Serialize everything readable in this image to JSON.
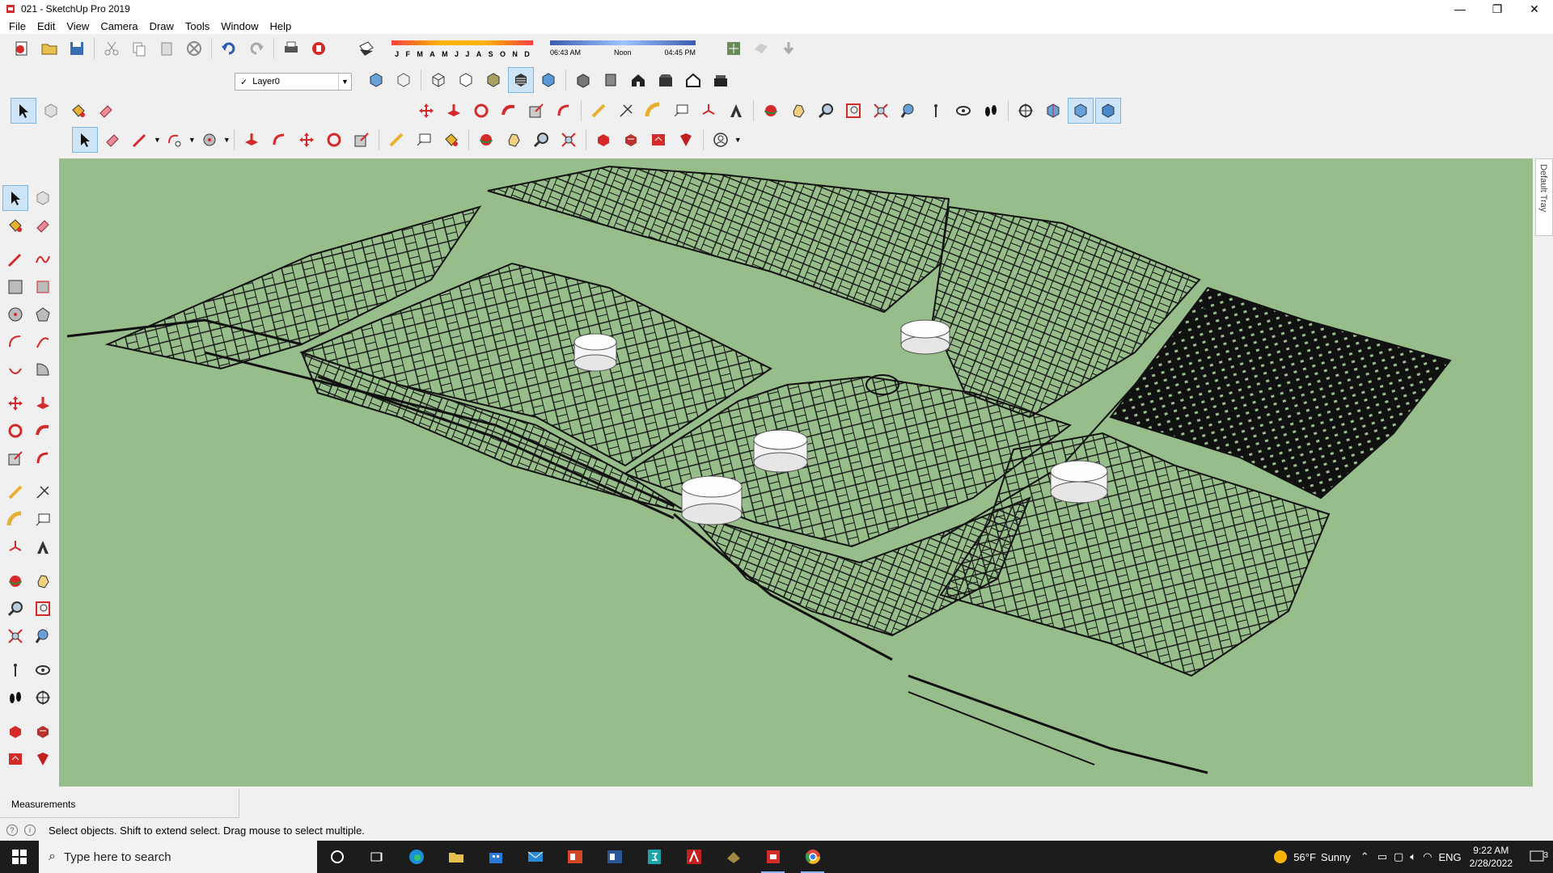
{
  "window": {
    "title": "021 - SketchUp Pro 2019",
    "controls": [
      "—",
      "❐",
      "✕"
    ]
  },
  "menu": [
    "File",
    "Edit",
    "View",
    "Camera",
    "Draw",
    "Tools",
    "Window",
    "Help"
  ],
  "shadow_settings": {
    "months": [
      "J",
      "F",
      "M",
      "A",
      "M",
      "J",
      "J",
      "A",
      "S",
      "O",
      "N",
      "D"
    ],
    "time_start": "06:43 AM",
    "time_mid": "Noon",
    "time_end": "04:45 PM"
  },
  "layer": {
    "current": "Layer0",
    "check": "✓"
  },
  "tray": {
    "label": "Default Tray"
  },
  "measurements": {
    "label": "Measurements"
  },
  "status": {
    "message": "Select objects. Shift to extend select. Drag mouse to select multiple."
  },
  "taskbar": {
    "search_placeholder": "Type here to search",
    "weather_temp": "56°F",
    "weather_cond": "Sunny",
    "language": "ENG",
    "time": "9:22 AM",
    "date": "2/28/2022",
    "notifications": "3"
  },
  "colors": {
    "viewport_bg": "#97bd8b",
    "taskbar_bg": "#1c1c1c",
    "active_tool": "#cde4f7"
  }
}
